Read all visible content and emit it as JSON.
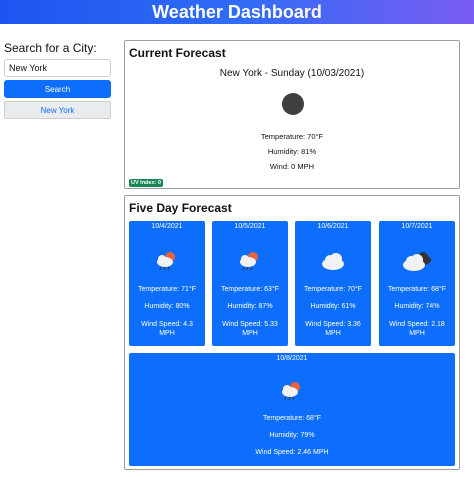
{
  "header": {
    "title": "Weather Dashboard"
  },
  "search": {
    "label": "Search for a City:",
    "value": "New York",
    "button_label": "Search",
    "history": [
      "New York"
    ]
  },
  "current": {
    "title": "Current Forecast",
    "city_date": "New York - Sunday (10/03/2021)",
    "icon": "dark-circle-icon",
    "temperature": "Temperature: 70°F",
    "humidity": "Humidity: 81%",
    "wind": "Wind: 0 MPH",
    "uv": "UV Index: 0",
    "uv_color": "#198754"
  },
  "five_day": {
    "title": "Five Day Forecast",
    "cards": [
      {
        "date": "10/4/2021",
        "icon": "cloud-sun-rain-icon",
        "temp": "Temperature: 71°F",
        "humidity": "Humidity: 80%",
        "wind1": "Wind Speed: 4.3",
        "wind2": "MPH"
      },
      {
        "date": "10/5/2021",
        "icon": "cloud-sun-rain-icon",
        "temp": "Temperature: 63°F",
        "humidity": "Humidity: 87%",
        "wind1": "Wind Speed: 5.33",
        "wind2": "MPH"
      },
      {
        "date": "10/6/2021",
        "icon": "cloud-icon",
        "temp": "Temperature: 70°F",
        "humidity": "Humidity: 61%",
        "wind1": "Wind Speed: 3.36",
        "wind2": "MPH"
      },
      {
        "date": "10/7/2021",
        "icon": "clouds-icon",
        "temp": "Temperature: 68°F",
        "humidity": "Humidity: 74%",
        "wind1": "Wind Speed: 2.18",
        "wind2": "MPH"
      },
      {
        "date": "10/8/2021",
        "icon": "cloud-sun-rain-icon",
        "temp": "Temperature: 68°F",
        "humidity": "Humidity: 79%",
        "wind1": "Wind Speed: 2.46 MPH",
        "wind2": ""
      }
    ]
  },
  "colors": {
    "accent": "#0d6efd",
    "header_start": "#1e54f0",
    "header_end": "#7a5cf2"
  }
}
